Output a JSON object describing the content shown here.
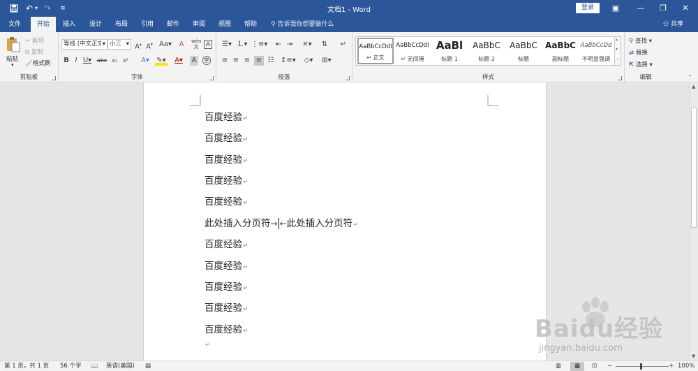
{
  "window": {
    "title": "文档1 - Word",
    "login_label": "登录",
    "quick_access": [
      "save-icon",
      "undo-icon",
      "redo-icon",
      "customize-icon"
    ]
  },
  "tabs": [
    {
      "label": "文件"
    },
    {
      "label": "开始"
    },
    {
      "label": "插入"
    },
    {
      "label": "设计"
    },
    {
      "label": "布局"
    },
    {
      "label": "引用"
    },
    {
      "label": "邮件"
    },
    {
      "label": "审阅"
    },
    {
      "label": "视图"
    },
    {
      "label": "帮助"
    }
  ],
  "active_tab": "开始",
  "tell_me": "告诉我你想要做什么",
  "share_label": "共享",
  "ribbon": {
    "clipboard": {
      "label": "剪贴板",
      "paste": "粘贴",
      "cut": "剪切",
      "copy": "复制",
      "format_painter": "格式刷"
    },
    "font": {
      "label": "字体",
      "font_name": "等线 (中文正文)",
      "font_size": "小三"
    },
    "paragraph": {
      "label": "段落"
    },
    "styles": {
      "label": "样式",
      "items": [
        {
          "sample": "AaBbCcDdI",
          "name": "↵ 正文"
        },
        {
          "sample": "AaBbCcDdI",
          "name": "↵ 无间隔"
        },
        {
          "sample": "AaBl",
          "name": "标题 1"
        },
        {
          "sample": "AaBbC",
          "name": "标题 2"
        },
        {
          "sample": "AaBbC",
          "name": "标题"
        },
        {
          "sample": "AaBbC",
          "name": "副标题"
        },
        {
          "sample": "AaBbCcDd",
          "name": "不明显强调"
        }
      ]
    },
    "editing": {
      "label": "编辑",
      "find": "查找",
      "replace": "替换",
      "select": "选择"
    }
  },
  "document": {
    "lines_before": [
      "百度经验",
      "百度经验",
      "百度经验",
      "百度经验",
      "百度经验"
    ],
    "break_line": {
      "left": "此处插入分页符",
      "right": "此处插入分页符"
    },
    "lines_after": [
      "百度经验",
      "百度经验",
      "百度经验",
      "百度经验",
      "百度经验"
    ],
    "paragraph_mark": "↵"
  },
  "status": {
    "page": "第 1 页，共 1 页",
    "words": "56 个字",
    "language": "英语(美国)",
    "zoom": "100%"
  },
  "watermark": {
    "logo": "Baidu经验",
    "url": "jingyan.baidu.com"
  }
}
